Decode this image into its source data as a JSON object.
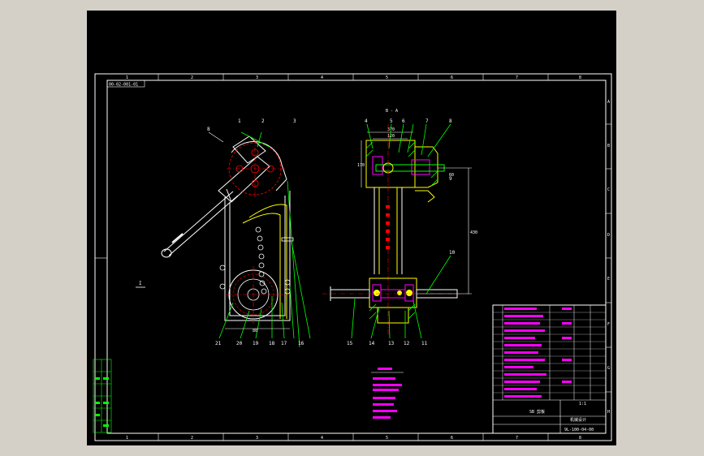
{
  "drawing": {
    "code_top_left": "00-02-001-01",
    "code_bottom_right": "9L-100-04-00",
    "view_label": "B - A",
    "section_label": "I",
    "zone_numbers_top": [
      "1",
      "2",
      "3",
      "4",
      "5",
      "6",
      "7",
      "8"
    ],
    "zone_numbers_bottom": [
      "1",
      "2",
      "3",
      "4",
      "5",
      "6",
      "7",
      "8"
    ],
    "zone_letters_right": [
      "A",
      "B",
      "C",
      "D",
      "E",
      "F",
      "G",
      "H"
    ],
    "dims": {
      "span_top": "370",
      "span_top_inner": "120",
      "height_right": "430",
      "bore": "60",
      "left_vert": "170",
      "base": "80"
    },
    "left_view_callouts": [
      "8",
      "1",
      "2",
      "3",
      "21",
      "20",
      "19",
      "18",
      "17",
      "16"
    ],
    "right_view_callouts": [
      "4",
      "5",
      "6",
      "7",
      "8",
      "9",
      "10",
      "11",
      "12",
      "13",
      "14",
      "15"
    ],
    "title_block": {
      "title": "SB 剪板",
      "scale": "1:1",
      "company": "机械设计"
    },
    "colors": {
      "viewport_bg": "#000000",
      "frame": "#ffffff",
      "section_line": "#00ff00",
      "hidden_line": "#ff0000",
      "text_magenta": "#ff00ff",
      "part_yellow": "#ffff00",
      "outline_white": "#ffffff"
    }
  }
}
